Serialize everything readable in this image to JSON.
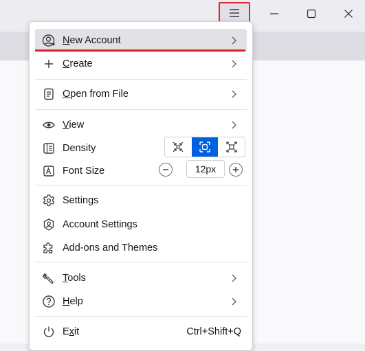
{
  "window": {
    "menu_button_icon": "hamburger-icon",
    "controls": [
      "minimize-icon",
      "maximize-icon",
      "close-icon"
    ],
    "highlight_color": "#e0252d",
    "accent_color": "#0061e0"
  },
  "menu": {
    "new_account": {
      "pre": "",
      "key": "N",
      "post": "ew Account",
      "icon": "new-account-icon",
      "submenu": true
    },
    "create": {
      "pre": "",
      "key": "C",
      "post": "reate",
      "icon": "plus-icon",
      "submenu": true
    },
    "open_from_file": {
      "pre": "",
      "key": "O",
      "post": "pen from File",
      "icon": "file-icon",
      "submenu": true
    },
    "view": {
      "pre": "",
      "key": "V",
      "post": "iew",
      "icon": "eye-icon",
      "submenu": true
    },
    "density": {
      "label": "Density",
      "icon": "density-icon",
      "options": [
        "compact",
        "normal",
        "relaxed"
      ],
      "selected": "normal"
    },
    "font_size": {
      "label": "Font Size",
      "icon": "font-size-icon",
      "value": "12px"
    },
    "settings": {
      "label": "Settings",
      "icon": "gear-icon"
    },
    "account_settings": {
      "label": "Account Settings",
      "icon": "account-settings-icon"
    },
    "addons": {
      "label": "Add-ons and Themes",
      "icon": "puzzle-icon"
    },
    "tools": {
      "pre": "",
      "key": "T",
      "post": "ools",
      "icon": "wrench-icon",
      "submenu": true
    },
    "help": {
      "pre": "",
      "key": "H",
      "post": "elp",
      "icon": "help-icon",
      "submenu": true
    },
    "exit": {
      "pre": "E",
      "key": "x",
      "post": "it",
      "icon": "power-icon",
      "shortcut": "Ctrl+Shift+Q"
    }
  }
}
